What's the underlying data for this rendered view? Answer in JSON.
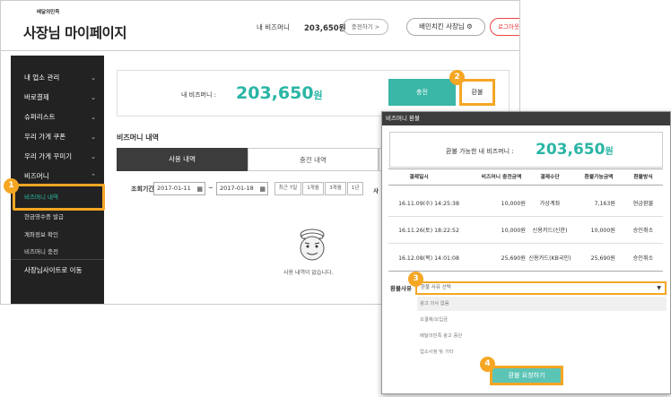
{
  "header": {
    "logo_small": "배달의민족",
    "logo_title": "사장님 마이페이지",
    "bizmoney_label": "내 비즈머니",
    "bizmoney_value": "203,650원",
    "charge_label": "충전하기 >",
    "owner_label": "배민치킨 사장님",
    "logout_label": "로그아웃"
  },
  "sidebar": {
    "items": [
      "내 업소 관리",
      "바로결제",
      "슈퍼리스트",
      "우리 가게 쿠폰",
      "우리 가게 꾸미기",
      "비즈머니"
    ],
    "subitems": [
      "비즈머니 내역",
      "현금영수증 발급",
      "계좌정보 확인",
      "비즈머니 충전"
    ],
    "footer_item": "사장님사이트로 이동"
  },
  "balance": {
    "label": "내 비즈머니 :",
    "value": "203,650",
    "unit": "원",
    "charge_btn": "충전",
    "refund_btn": "환불"
  },
  "history": {
    "title": "비즈머니 내역",
    "tabs": [
      "사용 내역",
      "충전 내역"
    ],
    "period_label": "조회기간",
    "start_date": "2017-01-11",
    "end_date": "2017-01-18",
    "quick": [
      "최근 7일",
      "1개월",
      "3개월",
      "1년"
    ],
    "sort_label": "사",
    "empty_text": "사용 내역이 없습니다."
  },
  "popup": {
    "title": "비즈머니 환불",
    "summary_label": "환불 가능한 내 비즈머니 :",
    "summary_value": "203,650",
    "summary_unit": "원",
    "columns": [
      "결제일시",
      "비즈머니 충전금액",
      "결제수단",
      "환불가능금액",
      "환불방식"
    ],
    "rows": [
      [
        "16.11.09(수) 14:25:38",
        "10,000원",
        "가상계좌",
        "7,163원",
        "현금환불"
      ],
      [
        "16.11.26(토) 18:22:52",
        "10,000원",
        "신용카드(신한)",
        "10,000원",
        "승인취소"
      ],
      [
        "16.12.08(목) 14:01:08",
        "25,690원",
        "신용카드(KB국민)",
        "25,690원",
        "승인취소"
      ]
    ],
    "reason_label": "환불사유",
    "select_placeholder": "환불 사유 선택",
    "options": [
      "광고 의사 없음",
      "오결제/오입금",
      "배달의민족 광고 중단",
      "업소사정 및 기타"
    ],
    "submit_label": "환불 요청하기"
  },
  "badges": [
    "1",
    "2",
    "3",
    "4"
  ],
  "colors": {
    "accent": "#3ab7a7",
    "highlight": "#f5a623",
    "sidebar": "#222222",
    "logout": "#e44444"
  }
}
